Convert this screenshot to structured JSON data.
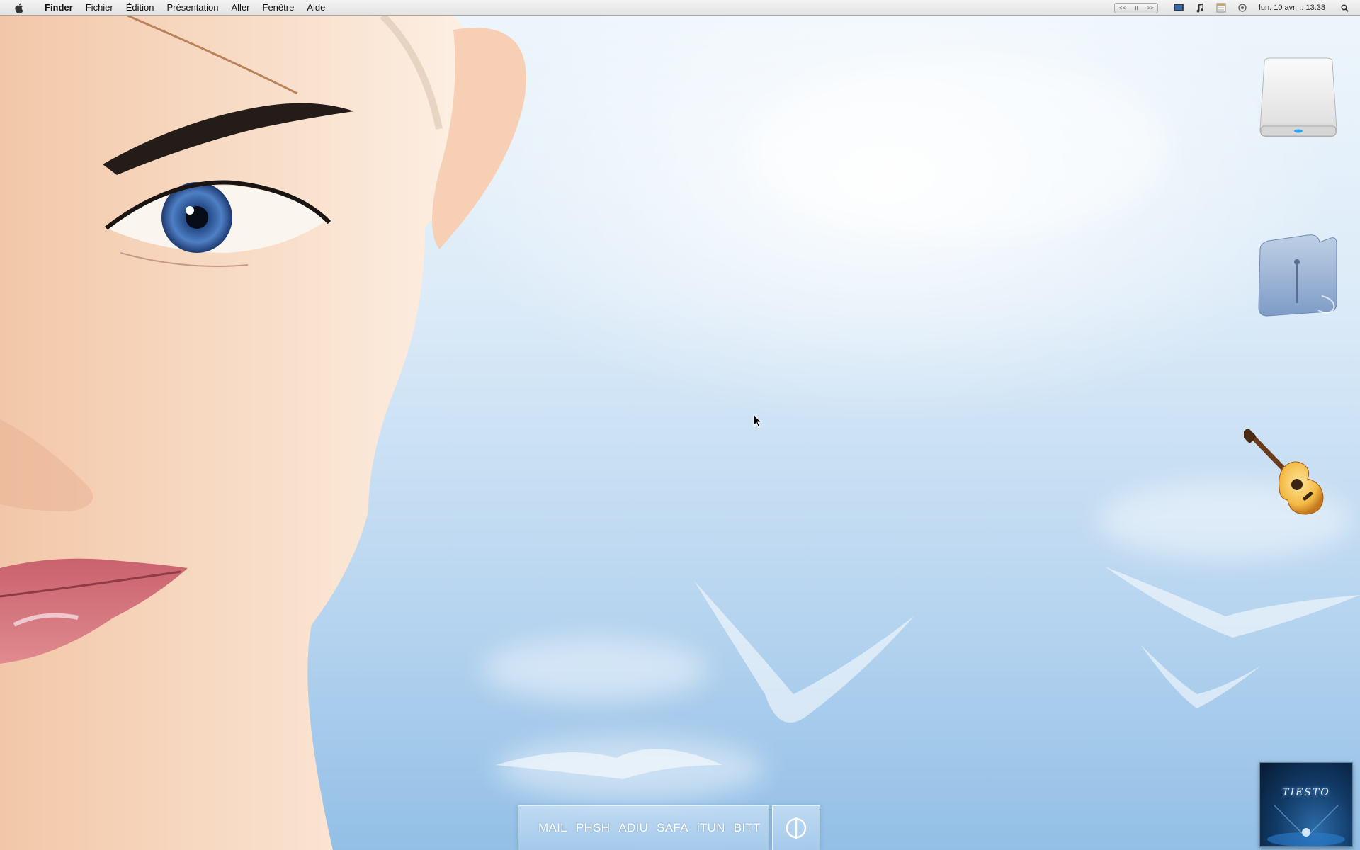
{
  "menubar": {
    "app_name": "Finder",
    "items": [
      {
        "label": "Fichier"
      },
      {
        "label": "Édition"
      },
      {
        "label": "Présentation"
      },
      {
        "label": "Aller"
      },
      {
        "label": "Fenêtre"
      },
      {
        "label": "Aide"
      }
    ],
    "media_controls": [
      "<<",
      "II",
      ">>"
    ],
    "clock": "lun. 10 avr. :: 13:38"
  },
  "desktop_icons": [
    {
      "name": "hard-drive-icon"
    },
    {
      "name": "folder-icon"
    },
    {
      "name": "guitar-icon"
    }
  ],
  "launcher": {
    "apps": [
      {
        "label": "MAIL"
      },
      {
        "label": "PHSH"
      },
      {
        "label": "ADIU"
      },
      {
        "label": "SAFA"
      },
      {
        "label": "iTUN"
      },
      {
        "label": "BITT"
      }
    ]
  },
  "album": {
    "title": "TIESTO"
  },
  "colors": {
    "sky_top": "#eef6fc",
    "sky_bottom": "#93bfe6",
    "menubar": "#e8e8e8",
    "skin": "#f6d5bd"
  }
}
